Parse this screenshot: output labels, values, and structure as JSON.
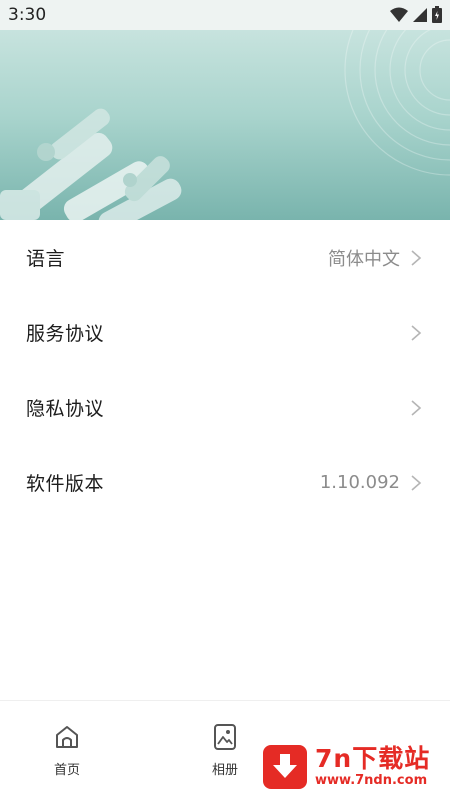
{
  "status_bar": {
    "time": "3:30"
  },
  "settings": [
    {
      "label": "语言",
      "value": "简体中文"
    },
    {
      "label": "服务协议",
      "value": ""
    },
    {
      "label": "隐私协议",
      "value": ""
    },
    {
      "label": "软件版本",
      "value": "1.10.092"
    }
  ],
  "tabs": [
    {
      "label": "首页",
      "icon": "home-icon"
    },
    {
      "label": "相册",
      "icon": "album-icon"
    }
  ],
  "watermark": {
    "title": "7n下载站",
    "url": "www.7ndn.com"
  },
  "colors": {
    "hero_top": "#c7e3de",
    "hero_bottom": "#79b4ad",
    "watermark_red": "#e52b25"
  }
}
